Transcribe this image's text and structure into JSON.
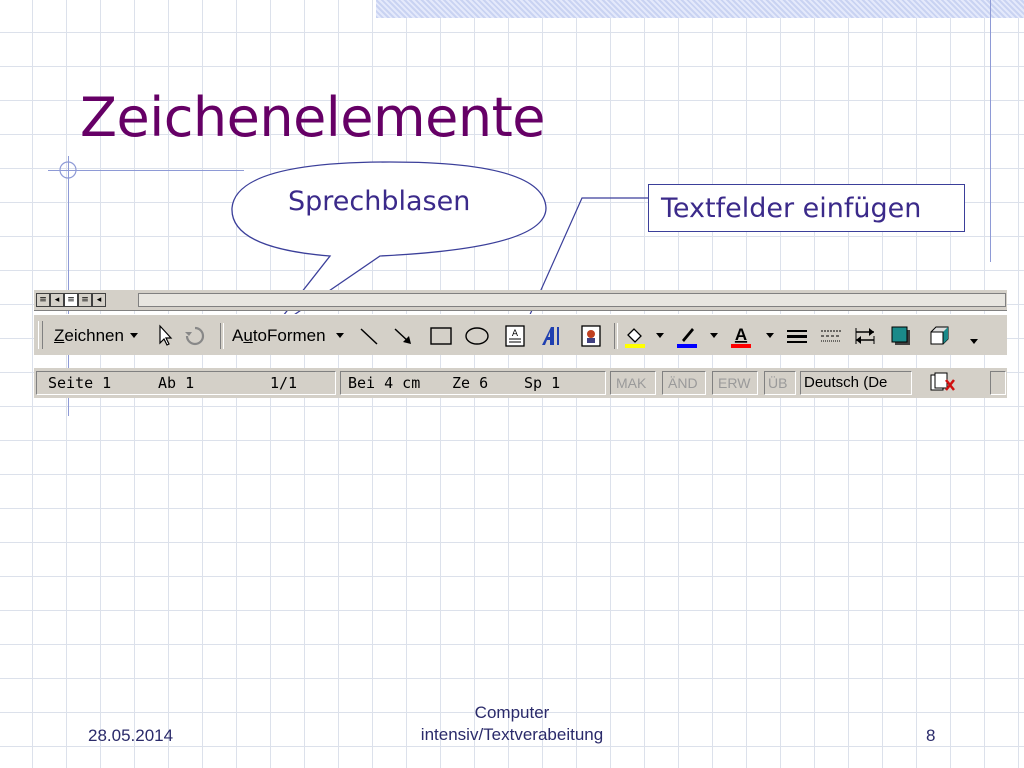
{
  "slide": {
    "title": "Zeichenelemente",
    "bubble_label": "Sprechblasen",
    "box_label": "Textfelder einfügen"
  },
  "toolbar": {
    "draw_label_pre": "",
    "draw_label_u": "Z",
    "draw_label_post": "eichnen",
    "autoshapes_pre": "A",
    "autoshapes_u": "u",
    "autoshapes_post": "toFormen",
    "icons": [
      "select-pointer-icon",
      "free-rotate-icon",
      "line-icon",
      "arrow-icon",
      "rectangle-icon",
      "oval-icon",
      "text-box-icon",
      "wordart-icon",
      "clip-art-icon",
      "fill-color-icon",
      "line-color-icon",
      "font-color-icon",
      "line-style-icon",
      "dash-style-icon",
      "arrow-style-icon",
      "shadow-icon",
      "3d-icon"
    ],
    "colors": {
      "fill": "#ffff00",
      "line": "#0000ff",
      "font": "#ff0000"
    }
  },
  "statusbar": {
    "page": "Seite 1",
    "section": "Ab 1",
    "pages": "1/1",
    "position": "Bei 4 cm",
    "line": "Ze 6",
    "column": "Sp 1",
    "mak": "MAK",
    "and": "ÄND",
    "erw": "ERW",
    "ub": "ÜB",
    "language": "Deutsch (De"
  },
  "footer": {
    "date": "28.05.2014",
    "center_line1": "Computer",
    "center_line2": "intensiv/Textverabeitung",
    "page_number": "8"
  }
}
